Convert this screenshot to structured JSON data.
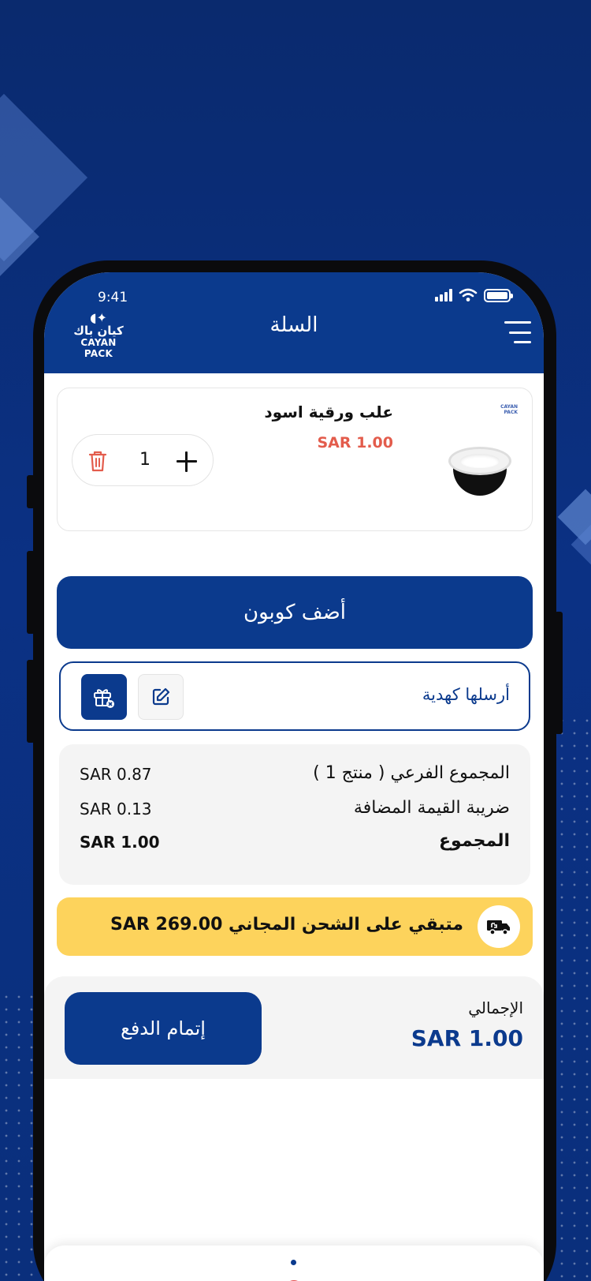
{
  "status_bar": {
    "time": "9:41"
  },
  "header": {
    "title": "السلة",
    "logo_ar": "كيان باك",
    "logo_en": "CAYAN PACK"
  },
  "cart": {
    "items": [
      {
        "name": "علب ورقية اسود",
        "price": "SAR 1.00",
        "quantity": "1",
        "brand": "CAYAN PACK"
      }
    ]
  },
  "coupon": {
    "label": "أضف كوبون"
  },
  "gift": {
    "label": "أرسلها كهدية"
  },
  "summary": {
    "subtotal_label": "المجموع الفرعي ( منتج 1 )",
    "subtotal_value": "SAR 0.87",
    "vat_label": "ضريبة القيمة المضافة",
    "vat_value": "SAR 0.13",
    "total_label": "المجموع",
    "total_value": "SAR 1.00"
  },
  "shipping": {
    "text": "متبقي على الشحن المجاني SAR 269.00"
  },
  "checkout": {
    "grand_label": "الإجمالي",
    "grand_value": "SAR 1.00",
    "pay_label": "إتمام الدفع"
  },
  "colors": {
    "primary": "#0b3a8d",
    "price": "#e35c4c",
    "shipping_bg": "#fdd35c",
    "badge": "#e34b4b"
  },
  "icons": [
    "menu-icon",
    "trash-icon",
    "plus-icon",
    "gift-icon",
    "edit-icon",
    "truck-icon",
    "signal-icon",
    "wifi-icon",
    "battery-icon"
  ]
}
